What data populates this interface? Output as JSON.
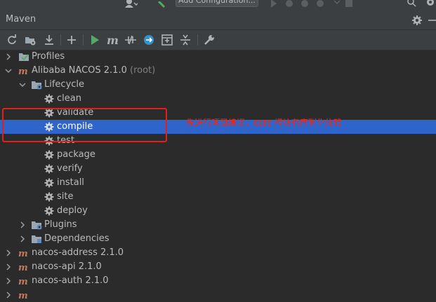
{
  "topbar": {
    "config_label": "Add Configuration..."
  },
  "panel": {
    "title": "Maven"
  },
  "toolbar": {
    "icons": [
      "refresh-icon",
      "add-folder-icon",
      "download-icon",
      "plus-icon",
      "run-icon",
      "execute-goal-icon",
      "toggle-offline-icon",
      "skip-tests-icon",
      "show-dependencies-icon",
      "collapse-all-icon",
      "settings-wrench-icon"
    ],
    "run_color": "#59a869",
    "accent_blue": "#3592c4"
  },
  "tree": {
    "profiles": "Profiles",
    "root": {
      "label": "Alibaba NACOS 2.1.0",
      "suffix": "(root)"
    },
    "lifecycle": "Lifecycle",
    "goals": [
      "clean",
      "validate",
      "compile",
      "test",
      "package",
      "verify",
      "install",
      "site",
      "deploy"
    ],
    "selected_goal": "compile",
    "plugins": "Plugins",
    "dependencies": "Dependencies",
    "modules": [
      "nacos-address 2.1.0",
      "nacos-api 2.1.0",
      "nacos-auth 2.1.0"
    ]
  },
  "annotation": {
    "text": "先进行项目编译，core 模块有序列化依赖",
    "color": "#e8281f"
  },
  "colors": {
    "selection": "#2f65ca",
    "panel_bg": "#2b2b2b",
    "header_bg": "#3c3f41"
  }
}
